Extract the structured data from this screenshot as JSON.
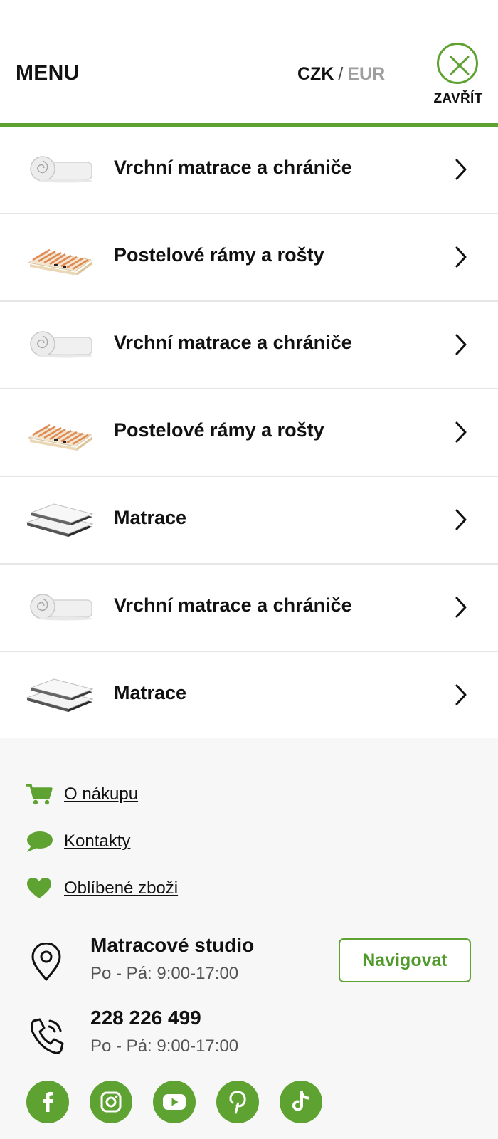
{
  "header": {
    "menu_title": "MENU",
    "currency": {
      "active": "CZK",
      "separator": "/",
      "inactive": "EUR"
    },
    "close_label": "ZAVŘÍT"
  },
  "categories": [
    {
      "label": "Vrchní matrace a chrániče",
      "icon": "mattress-topper-roll-image"
    },
    {
      "label": "Postelové rámy a rošty",
      "icon": "slatted-bed-frame-image"
    },
    {
      "label": "Vrchní matrace a chrániče",
      "icon": "mattress-topper-roll-image"
    },
    {
      "label": "Postelové rámy a rošty",
      "icon": "slatted-bed-frame-image"
    },
    {
      "label": "Matrace",
      "icon": "mattresses-image"
    },
    {
      "label": "Vrchní matrace a chrániče",
      "icon": "mattress-topper-roll-image"
    },
    {
      "label": "Matrace",
      "icon": "mattresses-image"
    }
  ],
  "footer": {
    "links": [
      {
        "label": "O nákupu",
        "icon": "cart-icon"
      },
      {
        "label": "Kontakty",
        "icon": "chat-bubble-icon"
      },
      {
        "label": "Oblíbené zboži",
        "icon": "heart-icon"
      }
    ],
    "studio": {
      "title": "Matracové studio",
      "hours": "Po - Pá: 9:00-17:00",
      "button": "Navigovat"
    },
    "phone": {
      "number": "228 226 499",
      "hours": "Po - Pá: 9:00-17:00"
    },
    "socials": [
      "facebook-icon",
      "instagram-icon",
      "youtube-icon",
      "pinterest-icon",
      "tiktok-icon"
    ]
  },
  "colors": {
    "accent": "#5ea232",
    "text": "#111111",
    "muted": "#9e9e9e",
    "footer_bg": "#f7f7f7"
  }
}
